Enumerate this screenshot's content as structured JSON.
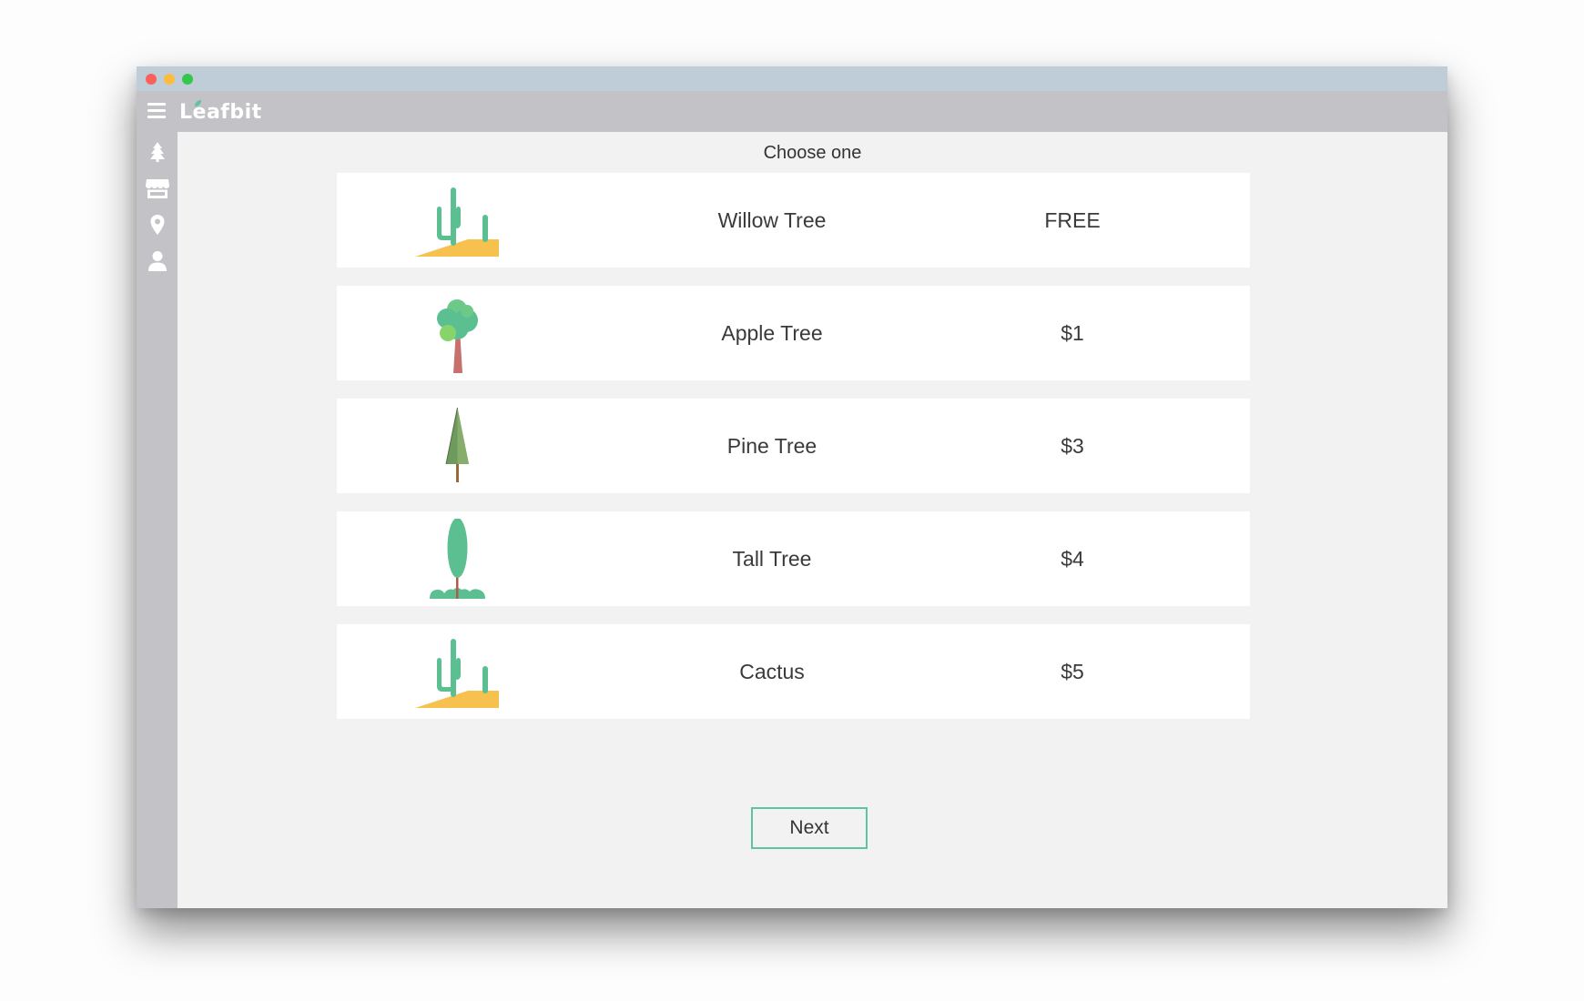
{
  "app": {
    "brand": "Leafbit"
  },
  "colors": {
    "titlebar": "#bfcdd8",
    "appbar": "#c3c2c7",
    "accent": "#5fc49b",
    "cactus_green": "#5bbf91",
    "sand": "#f6c14f"
  },
  "sidebar": {
    "items": [
      {
        "icon": "tree-icon"
      },
      {
        "icon": "store-icon"
      },
      {
        "icon": "location-pin-icon"
      },
      {
        "icon": "user-icon"
      }
    ]
  },
  "main": {
    "title": "Choose one",
    "trees": [
      {
        "name": "Willow Tree",
        "price": "FREE",
        "icon": "cactus-icon"
      },
      {
        "name": "Apple Tree",
        "price": "$1",
        "icon": "apple-tree-icon"
      },
      {
        "name": "Pine Tree",
        "price": "$3",
        "icon": "pine-tree-icon"
      },
      {
        "name": "Tall Tree",
        "price": "$4",
        "icon": "tall-tree-icon"
      },
      {
        "name": "Cactus",
        "price": "$5",
        "icon": "cactus-icon"
      }
    ],
    "next_label": "Next"
  }
}
